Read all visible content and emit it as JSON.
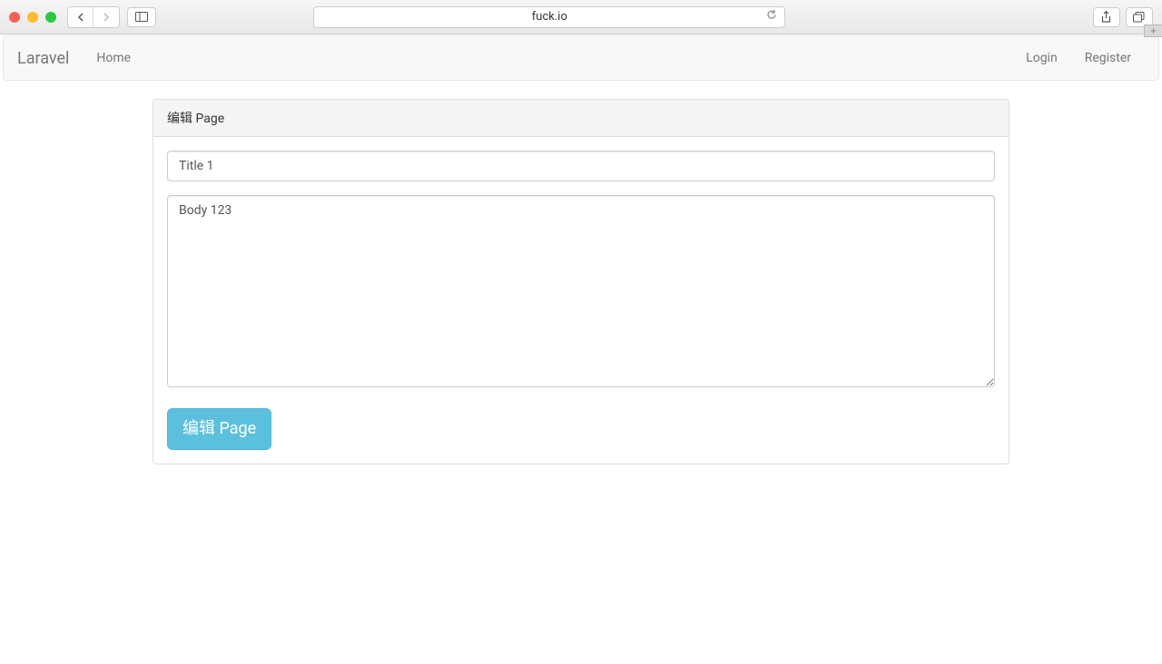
{
  "browser": {
    "url": "fuck.io"
  },
  "navbar": {
    "brand": "Laravel",
    "home": "Home",
    "login": "Login",
    "register": "Register"
  },
  "panel": {
    "heading": "编辑 Page"
  },
  "form": {
    "title_value": "Title 1",
    "body_value": "Body 123",
    "submit_label": "编辑 Page"
  }
}
